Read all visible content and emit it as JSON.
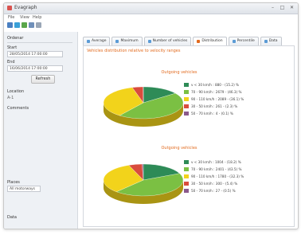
{
  "window": {
    "title": "Evagraph",
    "menu": [
      "File",
      "View",
      "Help"
    ]
  },
  "sidebar": {
    "section_title": "Ordenar",
    "start_label": "Start",
    "start_value": "28/05/2014 17:00:00",
    "end_label": "End",
    "end_value": "16/06/2014 17:00:00",
    "refresh_label": "Refresh",
    "location_label": "Location",
    "location_value": "A-1",
    "comments_label": "Comments",
    "places_label": "Places",
    "places_value": "All motorways",
    "data_label": "Data"
  },
  "tabs": [
    {
      "label": "Average",
      "active": false
    },
    {
      "label": "Maximum",
      "active": false
    },
    {
      "label": "Number of vehicles",
      "active": false
    },
    {
      "label": "Distribution",
      "active": true
    },
    {
      "label": "Percentile",
      "active": false
    },
    {
      "label": "Data",
      "active": false
    }
  ],
  "panel_title": "Vehicles distribution relative to velocity ranges",
  "chart_data": [
    {
      "type": "pie",
      "title": "Outgoing vehicles",
      "categories": [
        "v < 30 km/h",
        "70 - 90 km/h",
        "90 - 110 km/h",
        "30 - 50 km/h",
        "50 - 70 km/h"
      ],
      "values": [
        880,
        2679,
        2089,
        261,
        4
      ],
      "labels": [
        "880 - (15.2) %",
        "2679 - (46.3) %",
        "2089 - (36.1) %",
        "261 - (2.3) %",
        "4 - (0.1) %"
      ],
      "colors": [
        "#2e8b57",
        "#7bc043",
        "#f2d31b",
        "#d94c3d",
        "#8b5a8c"
      ]
    },
    {
      "type": "pie",
      "title": "Outgoing vehicles",
      "categories": [
        "v < 30 km/h",
        "70 - 90 km/h",
        "90 - 110 km/h",
        "30 - 50 km/h",
        "50 - 70 km/h"
      ],
      "values": [
        1004,
        2401,
        1780,
        300,
        27
      ],
      "labels": [
        "1004 - (18.2) %",
        "2401 - (43.5) %",
        "1780 - (32.3) %",
        "300 - (5.4) %",
        "27 - (0.5) %"
      ],
      "colors": [
        "#2e8b57",
        "#7bc043",
        "#f2d31b",
        "#d94c3d",
        "#8b5a8c"
      ]
    }
  ]
}
